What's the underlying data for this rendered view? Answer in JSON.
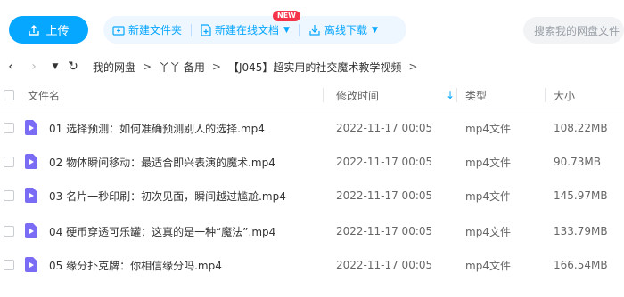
{
  "toolbar": {
    "upload_label": "上传",
    "new_folder_label": "新建文件夹",
    "new_online_doc_label": "新建在线文档",
    "new_badge": "NEW",
    "offline_download_label": "离线下载",
    "search_placeholder": "搜索我的网盘文件"
  },
  "breadcrumb": [
    "我的网盘",
    "丫丫 备用",
    "【J045】超实用的社交魔术教学视频"
  ],
  "columns": {
    "name": "文件名",
    "modified": "修改时间",
    "type": "类型",
    "size": "大小"
  },
  "files": [
    {
      "name": "01 选择预测：如何准确预测别人的选择.mp4",
      "modified": "2022-11-17 00:05",
      "type": "mp4文件",
      "size": "108.22MB"
    },
    {
      "name": "02 物体瞬间移动：最适合即兴表演的魔术.mp4",
      "modified": "2022-11-17 00:05",
      "type": "mp4文件",
      "size": "90.73MB"
    },
    {
      "name": "03 名片一秒印刷：初次见面，瞬间越过尴尬.mp4",
      "modified": "2022-11-17 00:05",
      "type": "mp4文件",
      "size": "145.97MB"
    },
    {
      "name": "04 硬币穿透可乐罐：这真的是一种“魔法”.mp4",
      "modified": "2022-11-17 00:05",
      "type": "mp4文件",
      "size": "133.79MB"
    },
    {
      "name": "05 缘分扑克牌：你相信缘分吗.mp4",
      "modified": "2022-11-17 00:05",
      "type": "mp4文件",
      "size": "166.54MB"
    }
  ]
}
